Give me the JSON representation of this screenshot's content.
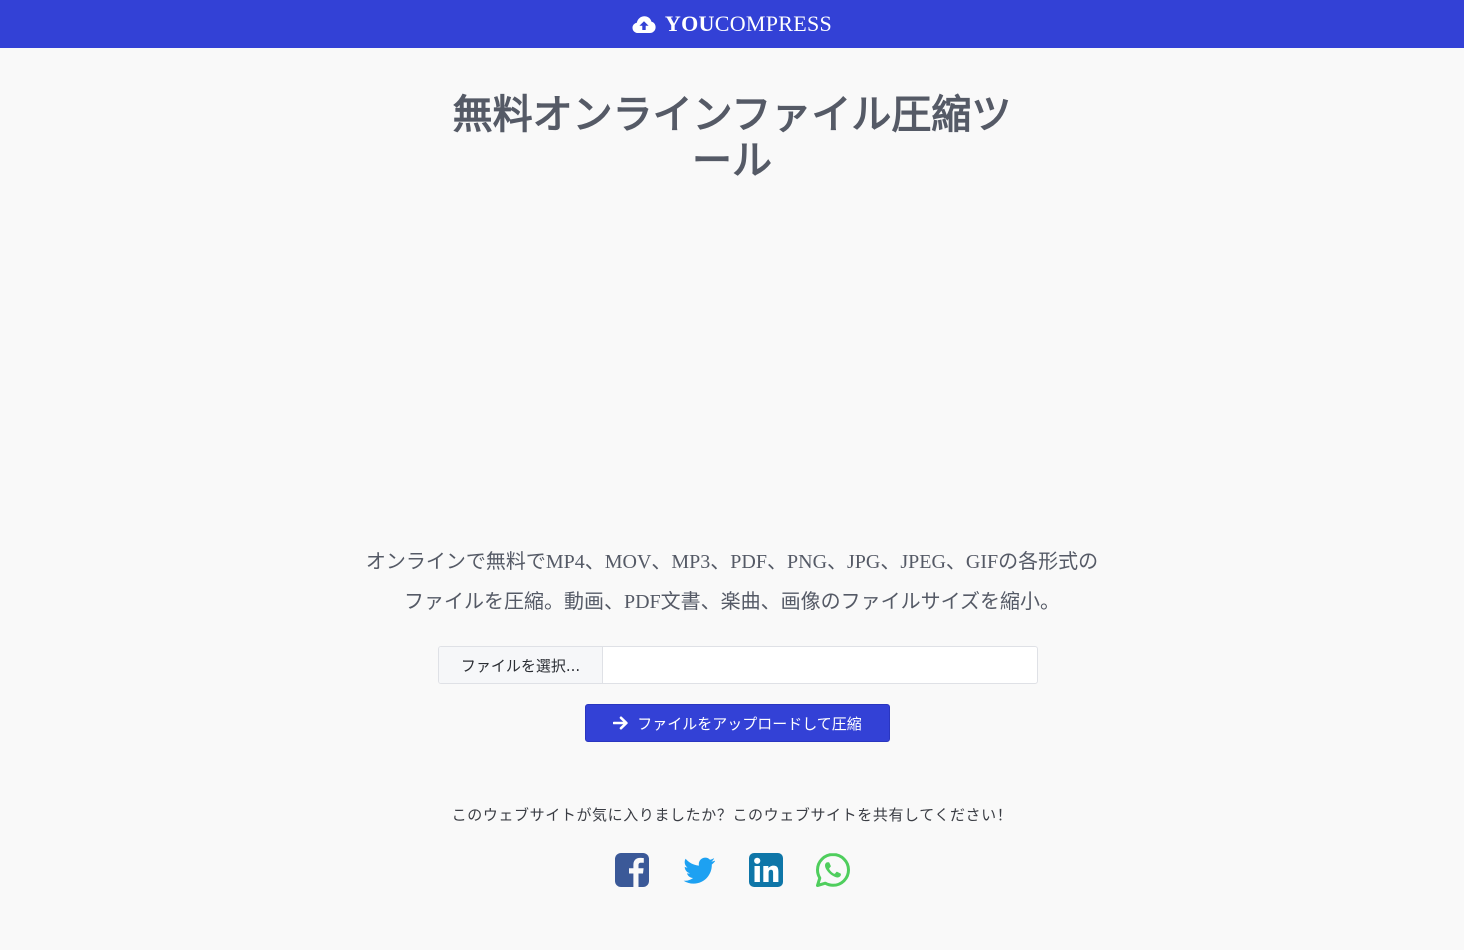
{
  "header": {
    "brand_bold": "YOU",
    "brand_rest": "COMPRESS",
    "icon": "cloud-upload-icon",
    "background": "#3341d6"
  },
  "main": {
    "title": "無料オンラインファイル圧縮ツール",
    "description": "オンラインで無料でMP4、MOV、MP3、PDF、PNG、JPG、JPEG、GIFの各形式のファイルを圧縮。動画、PDF文書、楽曲、画像のファイルサイズを縮小。",
    "file_input": {
      "button_label": "ファイルを選択..."
    },
    "upload_button": {
      "label": "ファイルをアップロードして圧縮",
      "icon": "arrow-right-icon"
    }
  },
  "share": {
    "text": "このウェブサイトが気に入りましたか？このウェブサイトを共有してください！",
    "links": [
      {
        "name": "facebook",
        "icon": "facebook-icon",
        "color": "#3b5998"
      },
      {
        "name": "twitter",
        "icon": "twitter-icon",
        "color": "#1da1f2"
      },
      {
        "name": "linkedin",
        "icon": "linkedin-icon",
        "color": "#0e76a8"
      },
      {
        "name": "whatsapp",
        "icon": "whatsapp-icon",
        "color": "#4fce5d"
      }
    ]
  }
}
